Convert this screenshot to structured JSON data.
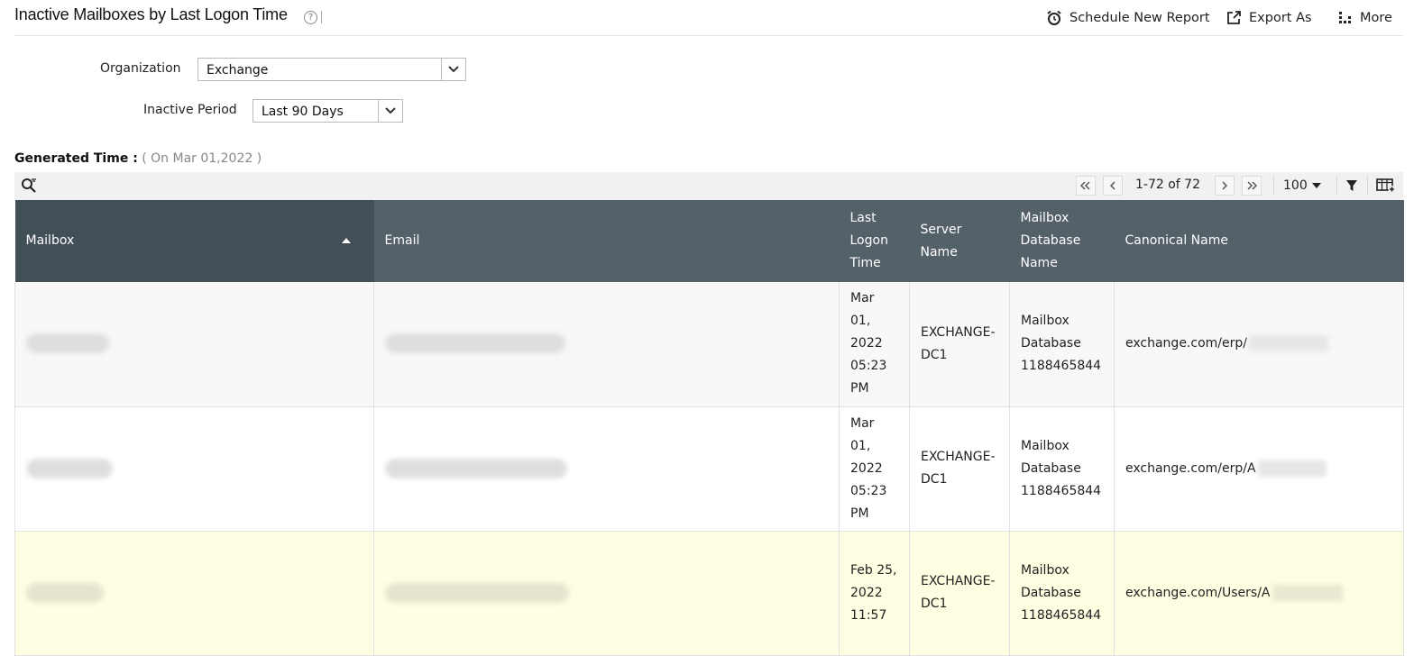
{
  "header": {
    "title": "Inactive Mailboxes by Last Logon Time",
    "help_glyph": "?",
    "actions": {
      "schedule_label": "Schedule New Report",
      "export_label": "Export As",
      "more_label": "More"
    }
  },
  "filters": {
    "organization_label": "Organization",
    "organization_value": "Exchange",
    "inactive_period_label": "Inactive Period",
    "inactive_period_value": "Last 90 Days"
  },
  "generated": {
    "label": "Generated Time :",
    "value": "( On Mar 01,2022 )"
  },
  "toolbar": {
    "range_text": "1-72 of 72",
    "page_size": "100"
  },
  "table": {
    "columns": [
      "Mailbox",
      "Email",
      "Last Logon Time",
      "Server Name",
      "Mailbox Database Name",
      "Canonical Name"
    ],
    "rows": [
      {
        "last_logon": "Mar 01, 2022 05:23 PM",
        "server": "EXCHANGE-DC1",
        "database": "Mailbox Database 1188465844",
        "canonical": "exchange.com/erp/"
      },
      {
        "last_logon": "Mar 01, 2022 05:23 PM",
        "server": "EXCHANGE-DC1",
        "database": "Mailbox Database 1188465844",
        "canonical": "exchange.com/erp/A"
      },
      {
        "last_logon": "Feb 25, 2022 11:57",
        "server": "EXCHANGE-DC1",
        "database": "Mailbox Database 1188465844",
        "canonical": "exchange.com/Users/A"
      }
    ]
  },
  "colors": {
    "header_bg": "#556168",
    "sorted_header_bg": "#434f56",
    "highlight_row": "#fefee2",
    "toolbar_bg": "#f1f1f1"
  }
}
